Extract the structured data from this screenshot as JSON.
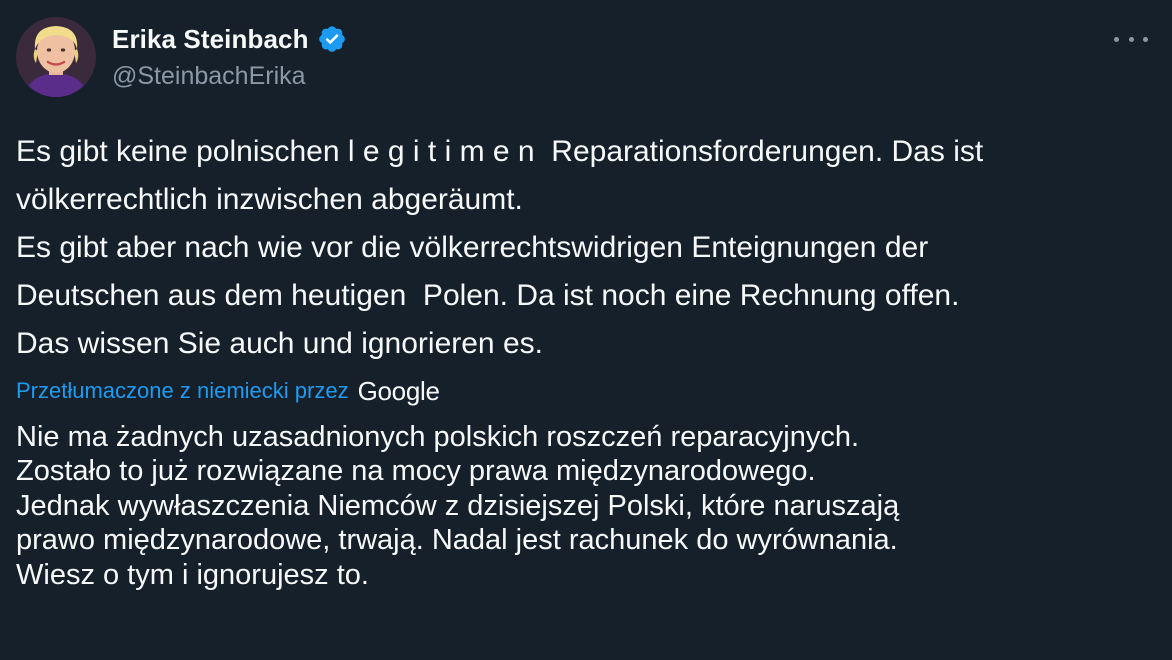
{
  "author": {
    "display_name": "Erika Steinbach",
    "handle": "@SteinbachErika",
    "verified": true,
    "verified_color": "#1d9bf0"
  },
  "menu": {
    "icon": "more-horizontal-icon"
  },
  "tweet": {
    "lines": [
      "Es gibt keine polnischen l e g i t i m e n  Reparationsforderungen. Das ist",
      "völkerrechtlich inzwischen abgeräumt.",
      "Es gibt aber nach wie vor die völkerrechtswidrigen Enteignungen der",
      "Deutschen aus dem heutigen  Polen. Da ist noch eine Rechnung offen.",
      "Das wissen Sie auch und ignorieren es."
    ]
  },
  "translation": {
    "label": "Przetłumaczone z niemiecki przez",
    "provider": "Google",
    "link_color": "#1d9bf0",
    "lines": [
      "Nie ma żadnych uzasadnionych polskich roszczeń reparacyjnych.",
      "Zostało to już rozwiązane na mocy prawa międzynarodowego.",
      "Jednak wywłaszczenia Niemców z dzisiejszej Polski, które naruszają",
      "prawo międzynarodowe, trwają. Nadal jest rachunek do wyrównania.",
      "Wiesz o tym i ignorujesz to."
    ]
  },
  "colors": {
    "background": "#15202b",
    "text_primary": "#f7f9f9",
    "text_secondary": "#8b98a5"
  }
}
